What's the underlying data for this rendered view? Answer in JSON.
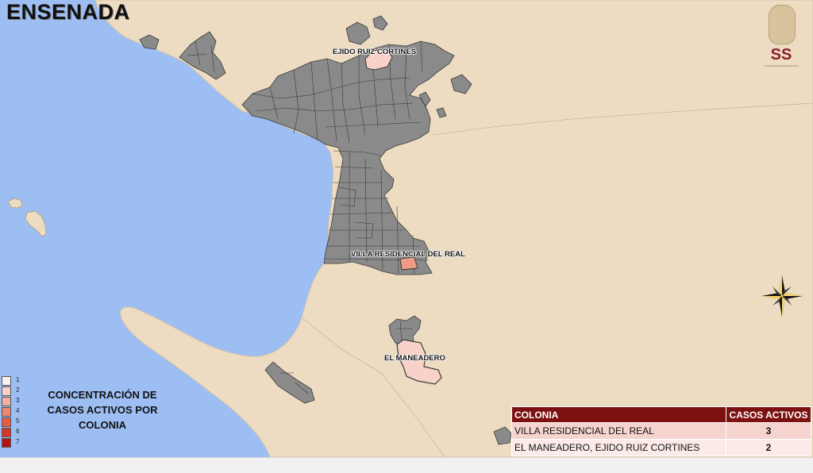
{
  "map": {
    "title": "ENSENADA",
    "colors": {
      "ocean": "#9dbef3",
      "land": "#eddbc2",
      "colonia_base": "#8a8a8a",
      "border": "#333333",
      "active_2": "#f8d2c8",
      "active_3": "#ee9a86"
    },
    "place_labels": [
      {
        "text": "EJIDO RUIZ CORTINES",
        "cases": 2
      },
      {
        "text": "VILLA RESIDENCIAL DEL REAL",
        "cases": 3
      },
      {
        "text": "EL MANEADERO",
        "cases": 2
      }
    ]
  },
  "logo": {
    "text": "SS"
  },
  "legend": {
    "title": "CONCENTRACIÓN DE CASOS ACTIVOS POR COLONIA",
    "items": [
      {
        "value": "1",
        "color": "#fbf2ef"
      },
      {
        "value": "2",
        "color": "#f8d2c8"
      },
      {
        "value": "3",
        "color": "#f3b19f"
      },
      {
        "value": "4",
        "color": "#ee8870"
      },
      {
        "value": "5",
        "color": "#e85a42"
      },
      {
        "value": "6",
        "color": "#d8342a"
      },
      {
        "value": "7",
        "color": "#b21515"
      }
    ]
  },
  "table": {
    "headers": [
      "COLONIA",
      "CASOS ACTIVOS"
    ],
    "rows": [
      [
        "VILLA RESIDENCIAL DEL REAL",
        "3"
      ],
      [
        "EL MANEADERO, EJIDO RUIZ CORTINES",
        "2"
      ]
    ]
  },
  "compass": {
    "icon": "compass-rose-icon"
  }
}
